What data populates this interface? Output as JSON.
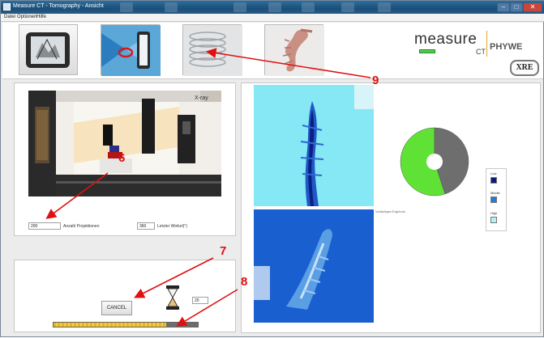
{
  "window": {
    "title": "Measure CT - Tomography - Ansicht",
    "controls": [
      "–",
      "□",
      "✕"
    ]
  },
  "menu": [
    "Datei",
    "Optionen",
    "Hilfe"
  ],
  "toolbar": {
    "buttons": [
      {
        "name": "tablet-3d-view",
        "icon": "tablet-scan-icon"
      },
      {
        "name": "xray-setup",
        "icon": "xray-rotation-icon"
      },
      {
        "name": "reconstruction",
        "icon": "reconstruction-stack-icon"
      },
      {
        "name": "seahorse-3d",
        "icon": "seahorse-3d-icon"
      }
    ]
  },
  "brand": {
    "measure": "measure",
    "ct": "CT",
    "phywe": "PHYWE",
    "xre": "XRE",
    "accent": "#4fc94f"
  },
  "setup": {
    "xray_label": "X-ray",
    "projections_value": "200",
    "projections_label": "Anzahl Projektionen",
    "angle_value": "360",
    "angle_label": "Letzter Winkel(°)"
  },
  "scan": {
    "cancel_label": "CANCEL",
    "counter_value": "20",
    "progress": 0.78,
    "progress_color": "#f6cf3c"
  },
  "results": {
    "preview_label": "Vorläufiges Ergebnis",
    "pie": {
      "filled_fraction": 0.55,
      "filled_color": "#5fe235",
      "rest_color": "#6e6e6e"
    },
    "legend": [
      {
        "label": "Low",
        "color": "#0a1a80"
      },
      {
        "label": "Middle",
        "color": "#1e7ed8"
      },
      {
        "label": "High",
        "color": "#aef3f7"
      }
    ]
  },
  "callouts": [
    "6",
    "7",
    "8",
    "9"
  ],
  "callout_color": "#e01010"
}
